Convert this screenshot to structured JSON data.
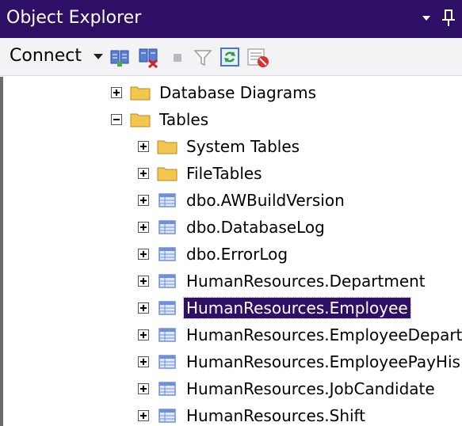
{
  "panel": {
    "title": "Object Explorer"
  },
  "toolbar": {
    "connect_label": "Connect",
    "icons": [
      "connect-object-explorer-icon",
      "disconnect-icon",
      "stop-icon",
      "filter-icon",
      "refresh-icon",
      "activity-monitor-icon"
    ]
  },
  "tree": {
    "nodes": [
      {
        "label": "Database Diagrams",
        "icon": "folder-icon",
        "expanded": false
      },
      {
        "label": "Tables",
        "icon": "folder-icon",
        "expanded": true
      },
      {
        "label": "System Tables",
        "icon": "folder-icon",
        "expanded": false
      },
      {
        "label": "FileTables",
        "icon": "folder-icon",
        "expanded": false
      },
      {
        "label": "dbo.AWBuildVersion",
        "icon": "table-icon",
        "expanded": false
      },
      {
        "label": "dbo.DatabaseLog",
        "icon": "table-icon",
        "expanded": false
      },
      {
        "label": "dbo.ErrorLog",
        "icon": "table-icon",
        "expanded": false
      },
      {
        "label": "HumanResources.Department",
        "icon": "table-icon",
        "expanded": false
      },
      {
        "label": "HumanResources.Employee",
        "icon": "table-icon",
        "expanded": false,
        "selected": true
      },
      {
        "label": "HumanResources.EmployeeDepart",
        "icon": "table-icon",
        "expanded": false
      },
      {
        "label": "HumanResources.EmployeePayHis",
        "icon": "table-icon",
        "expanded": false
      },
      {
        "label": "HumanResources.JobCandidate",
        "icon": "table-icon",
        "expanded": false
      },
      {
        "label": "HumanResources.Shift",
        "icon": "table-icon",
        "expanded": false
      }
    ]
  },
  "colors": {
    "titlebar": "#2d0f66",
    "selection": "#2d0f66",
    "folder": "#f3c64f",
    "table": "#6f8fd6"
  }
}
